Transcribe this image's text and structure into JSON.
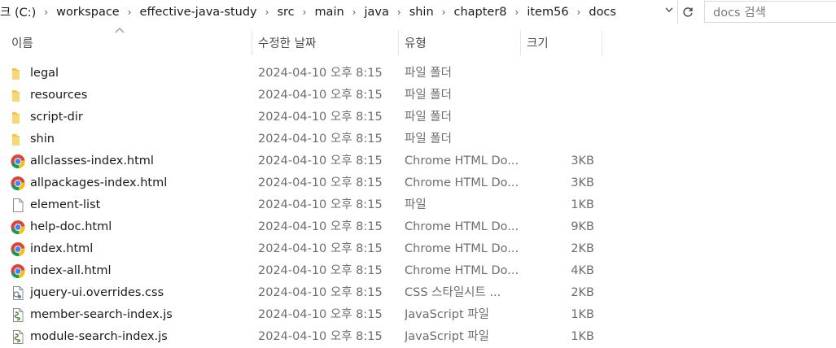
{
  "address_bar": {
    "breadcrumbs": [
      "크 (C:)",
      "workspace",
      "effective-java-study",
      "src",
      "main",
      "java",
      "shin",
      "chapter8",
      "item56",
      "docs"
    ],
    "separator": "›"
  },
  "search": {
    "placeholder": "docs 검색"
  },
  "columns": {
    "name": "이름",
    "date": "수정한 날짜",
    "type": "유형",
    "size": "크기"
  },
  "files": [
    {
      "name": "legal",
      "date": "2024-04-10 오후 8:15",
      "type": "파일 폴더",
      "size": "",
      "icon": "folder-icon"
    },
    {
      "name": "resources",
      "date": "2024-04-10 오후 8:15",
      "type": "파일 폴더",
      "size": "",
      "icon": "folder-icon"
    },
    {
      "name": "script-dir",
      "date": "2024-04-10 오후 8:15",
      "type": "파일 폴더",
      "size": "",
      "icon": "folder-icon"
    },
    {
      "name": "shin",
      "date": "2024-04-10 오후 8:15",
      "type": "파일 폴더",
      "size": "",
      "icon": "folder-icon"
    },
    {
      "name": "allclasses-index.html",
      "date": "2024-04-10 오후 8:15",
      "type": "Chrome HTML Do...",
      "size": "3KB",
      "icon": "chrome-icon"
    },
    {
      "name": "allpackages-index.html",
      "date": "2024-04-10 오후 8:15",
      "type": "Chrome HTML Do...",
      "size": "3KB",
      "icon": "chrome-icon"
    },
    {
      "name": "element-list",
      "date": "2024-04-10 오후 8:15",
      "type": "파일",
      "size": "1KB",
      "icon": "file-icon"
    },
    {
      "name": "help-doc.html",
      "date": "2024-04-10 오후 8:15",
      "type": "Chrome HTML Do...",
      "size": "9KB",
      "icon": "chrome-icon"
    },
    {
      "name": "index.html",
      "date": "2024-04-10 오후 8:15",
      "type": "Chrome HTML Do...",
      "size": "2KB",
      "icon": "chrome-icon"
    },
    {
      "name": "index-all.html",
      "date": "2024-04-10 오후 8:15",
      "type": "Chrome HTML Do...",
      "size": "4KB",
      "icon": "chrome-icon"
    },
    {
      "name": "jquery-ui.overrides.css",
      "date": "2024-04-10 오후 8:15",
      "type": "CSS 스타일시트 ...",
      "size": "2KB",
      "icon": "css-file-icon"
    },
    {
      "name": "member-search-index.js",
      "date": "2024-04-10 오후 8:15",
      "type": "JavaScript 파일",
      "size": "1KB",
      "icon": "js-file-icon"
    },
    {
      "name": "module-search-index.js",
      "date": "2024-04-10 오후 8:15",
      "type": "JavaScript 파일",
      "size": "1KB",
      "icon": "js-file-icon"
    }
  ],
  "colors": {
    "folder": "#f6c342",
    "chrome_red": "#db4437",
    "chrome_yellow": "#f4c20d",
    "chrome_green": "#0f9d58",
    "chrome_blue": "#4285f4"
  }
}
